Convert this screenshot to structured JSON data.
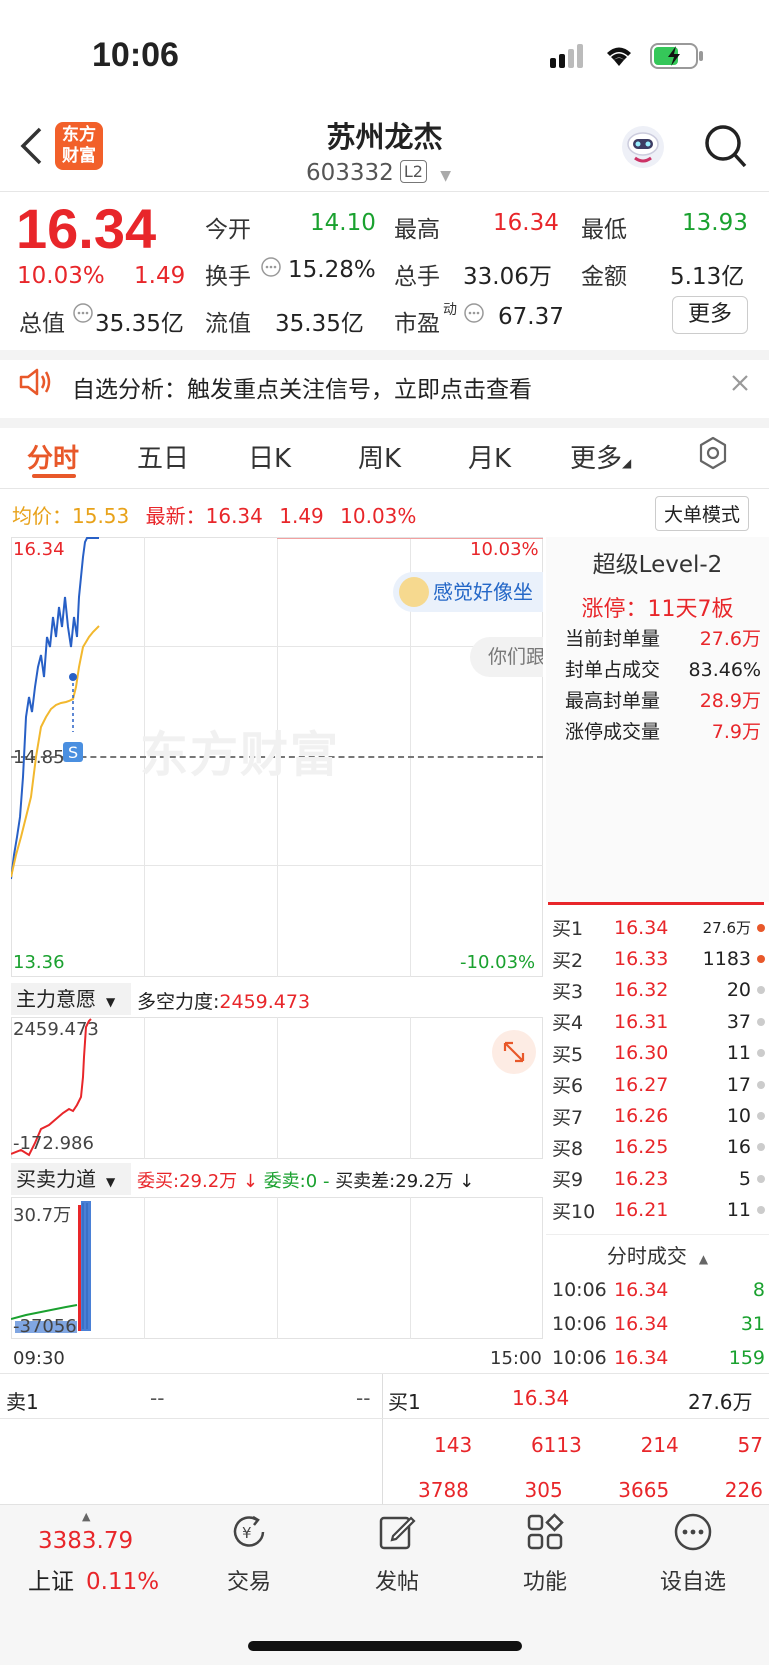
{
  "status": {
    "time": "10:06"
  },
  "header": {
    "logo_text": "东方财富",
    "title": "苏州龙杰",
    "code": "603332",
    "level": "L2"
  },
  "quote": {
    "price": "16.34",
    "change_pct": "10.03%",
    "change": "1.49",
    "open_label": "今开",
    "open": "14.10",
    "high_label": "最高",
    "high": "16.34",
    "low_label": "最低",
    "low": "13.93",
    "turnover_label": "换手",
    "turnover": "15.28%",
    "volume_label": "总手",
    "volume": "33.06万",
    "amount_label": "金额",
    "amount": "5.13亿",
    "mktcap_label": "总值",
    "mktcap": "35.35亿",
    "float_label": "流值",
    "float": "35.35亿",
    "pe_label": "市盈",
    "pe_sup": "动",
    "pe": "67.37",
    "more_button": "更多"
  },
  "notice": {
    "text": "自选分析：触发重点关注信号，立即点击查看"
  },
  "tabs": [
    "分时",
    "五日",
    "日K",
    "周K",
    "月K",
    "更多"
  ],
  "intraday": {
    "avg_label": "均价：",
    "avg": "15.53",
    "latest_label": "最新：",
    "latest": "16.34",
    "latest_change": "1.49",
    "latest_pct": "10.03%",
    "mode_button": "大单模式",
    "y_top": "16.34",
    "y_mid": "14.85",
    "y_bottom": "13.36",
    "pct_top": "10.03%",
    "pct_bottom": "-10.03%",
    "bubble1": "感觉好像坐",
    "bubble2": "你们跟",
    "watermark": "东方财富",
    "marker": "S"
  },
  "indicator1": {
    "name": "主力意愿",
    "label": "多空力度:",
    "value": "2459.473",
    "y_top": "2459.473",
    "y_bottom": "-172.986"
  },
  "indicator2": {
    "name": "买卖力道",
    "buy_label": "委买:",
    "buy": "29.2万",
    "sell_label": "委卖:",
    "sell": "0",
    "dash": "-",
    "diff_label": "买卖差:",
    "diff": "29.2万",
    "y_top": "30.7万",
    "y_bottom": "-37056",
    "x_start": "09:30",
    "x_end": "15:00"
  },
  "level2": {
    "title": "超级Level-2",
    "limit": "涨停：11天7板",
    "rows": [
      {
        "label": "当前封单量",
        "value": "27.6万"
      },
      {
        "label": "封单占成交",
        "value": "83.46%"
      },
      {
        "label": "最高封单量",
        "value": "28.9万"
      },
      {
        "label": "涨停成交量",
        "value": "7.9万"
      }
    ]
  },
  "orderbook": [
    {
      "label": "买1",
      "price": "16.34",
      "vol": "27.6万"
    },
    {
      "label": "买2",
      "price": "16.33",
      "vol": "1183"
    },
    {
      "label": "买3",
      "price": "16.32",
      "vol": "20"
    },
    {
      "label": "买4",
      "price": "16.31",
      "vol": "37"
    },
    {
      "label": "买5",
      "price": "16.30",
      "vol": "11"
    },
    {
      "label": "买6",
      "price": "16.27",
      "vol": "17"
    },
    {
      "label": "买7",
      "price": "16.26",
      "vol": "10"
    },
    {
      "label": "买8",
      "price": "16.25",
      "vol": "16"
    },
    {
      "label": "买9",
      "price": "16.23",
      "vol": "5"
    },
    {
      "label": "买10",
      "price": "16.21",
      "vol": "11"
    }
  ],
  "trades": {
    "title": "分时成交",
    "rows": [
      {
        "time": "10:06",
        "price": "16.34",
        "vol": "8"
      },
      {
        "time": "10:06",
        "price": "16.34",
        "vol": "31"
      },
      {
        "time": "10:06",
        "price": "16.34",
        "vol": "159"
      }
    ]
  },
  "bottom_book": {
    "sell_label": "卖1",
    "sell_price": "--",
    "sell_vol": "--",
    "buy_label": "买1",
    "buy_price": "16.34",
    "buy_vol": "27.6万",
    "row1": [
      "143",
      "6113",
      "214",
      "57"
    ],
    "row2": [
      "3788",
      "305",
      "3665",
      "226"
    ]
  },
  "bottom_nav": {
    "index_value": "3383.79",
    "index_name": "上证",
    "index_pct": "0.11%",
    "items": [
      "交易",
      "发帖",
      "功能",
      "设自选"
    ]
  }
}
